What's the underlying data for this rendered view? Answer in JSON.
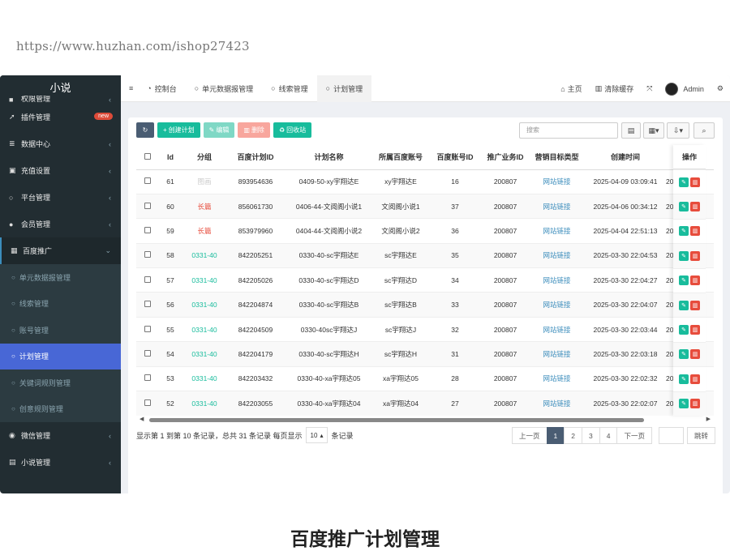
{
  "watermark": "https://www.huzhan.com/ishop27423",
  "sidebar": {
    "brand": "小说",
    "partial_item": "权限管理",
    "items_top": [
      {
        "label": "插件管理",
        "icon": "rocket-icon",
        "badge": "new"
      },
      {
        "label": "数据中心",
        "icon": "database-icon"
      },
      {
        "label": "充值设置",
        "icon": "card-icon"
      },
      {
        "label": "平台管理",
        "icon": "circle-icon"
      },
      {
        "label": "会员管理",
        "icon": "user-icon"
      }
    ],
    "open_group": {
      "label": "百度推广",
      "icon": "grid-icon"
    },
    "sub_items": [
      {
        "label": "单元数据报管理"
      },
      {
        "label": "线索管理"
      },
      {
        "label": "账号管理"
      },
      {
        "label": "计划管理",
        "active": true
      },
      {
        "label": "关键词规则管理"
      },
      {
        "label": "创意规则管理"
      }
    ],
    "items_bottom": [
      {
        "label": "微信管理",
        "icon": "wechat-icon"
      },
      {
        "label": "小说管理",
        "icon": "file-icon"
      }
    ]
  },
  "topbar": {
    "menu_icon": "≡",
    "tabs": [
      {
        "label": "控制台",
        "icon": "dashboard-icon"
      },
      {
        "label": "单元数据报管理",
        "icon": "circle-icon"
      },
      {
        "label": "线索管理",
        "icon": "circle-icon"
      },
      {
        "label": "计划管理",
        "icon": "circle-icon",
        "active": true
      }
    ],
    "home": "主页",
    "clear_cache": "清除缓存",
    "admin": "Admin"
  },
  "toolbar": {
    "refresh": "↻",
    "create": "创建计划",
    "edit": "编辑",
    "delete": "删除",
    "recycle": "回收站",
    "search_placeholder": "搜索"
  },
  "table": {
    "columns": [
      "Id",
      "分组",
      "百度计划ID",
      "计划名称",
      "所属百度账号",
      "百度账号ID",
      "推广业务ID",
      "营销目标类型",
      "创建时间",
      ""
    ],
    "op_header": "操作",
    "rows": [
      {
        "id": "61",
        "group": "图画",
        "group_color": "#cccccc",
        "plan_id": "893954636",
        "name": "0409-50-xy宇翔达E",
        "account": "xy宇翔达E",
        "account_id": "16",
        "biz_id": "200807",
        "target": "网站链接",
        "created": "2025-04-09 03:09:41",
        "extra": "20"
      },
      {
        "id": "60",
        "group": "长篇",
        "group_color": "#e74c3c",
        "plan_id": "856061730",
        "name": "0406-44-文阅阁小说1",
        "account": "文阅阁小说1",
        "account_id": "37",
        "biz_id": "200807",
        "target": "网站链接",
        "created": "2025-04-06 00:34:12",
        "extra": "20"
      },
      {
        "id": "59",
        "group": "长篇",
        "group_color": "#e74c3c",
        "plan_id": "853979960",
        "name": "0404-44-文阅阁小说2",
        "account": "文阅阁小说2",
        "account_id": "36",
        "biz_id": "200807",
        "target": "网站链接",
        "created": "2025-04-04 22:51:13",
        "extra": "20"
      },
      {
        "id": "58",
        "group": "0331-40",
        "group_color": "#18bc9c",
        "plan_id": "842205251",
        "name": "0330-40-sc宇翔达E",
        "account": "sc宇翔达E",
        "account_id": "35",
        "biz_id": "200807",
        "target": "网站链接",
        "created": "2025-03-30 22:04:53",
        "extra": "20"
      },
      {
        "id": "57",
        "group": "0331-40",
        "group_color": "#18bc9c",
        "plan_id": "842205026",
        "name": "0330-40-sc宇翔达D",
        "account": "sc宇翔达D",
        "account_id": "34",
        "biz_id": "200807",
        "target": "网站链接",
        "created": "2025-03-30 22:04:27",
        "extra": "20"
      },
      {
        "id": "56",
        "group": "0331-40",
        "group_color": "#18bc9c",
        "plan_id": "842204874",
        "name": "0330-40-sc宇翔达B",
        "account": "sc宇翔达B",
        "account_id": "33",
        "biz_id": "200807",
        "target": "网站链接",
        "created": "2025-03-30 22:04:07",
        "extra": "20"
      },
      {
        "id": "55",
        "group": "0331-40",
        "group_color": "#18bc9c",
        "plan_id": "842204509",
        "name": "0330-40sc宇翔达J",
        "account": "sc宇翔达J",
        "account_id": "32",
        "biz_id": "200807",
        "target": "网站链接",
        "created": "2025-03-30 22:03:44",
        "extra": "20"
      },
      {
        "id": "54",
        "group": "0331-40",
        "group_color": "#18bc9c",
        "plan_id": "842204179",
        "name": "0330-40-sc宇翔达H",
        "account": "sc宇翔达H",
        "account_id": "31",
        "biz_id": "200807",
        "target": "网站链接",
        "created": "2025-03-30 22:03:18",
        "extra": "20"
      },
      {
        "id": "53",
        "group": "0331-40",
        "group_color": "#18bc9c",
        "plan_id": "842203432",
        "name": "0330-40-xa宇翔达05",
        "account": "xa宇翔达05",
        "account_id": "28",
        "biz_id": "200807",
        "target": "网站链接",
        "created": "2025-03-30 22:02:32",
        "extra": "20"
      },
      {
        "id": "52",
        "group": "0331-40",
        "group_color": "#18bc9c",
        "plan_id": "842203055",
        "name": "0330-40-xa宇翔达04",
        "account": "xa宇翔达04",
        "account_id": "27",
        "biz_id": "200807",
        "target": "网站链接",
        "created": "2025-03-30 22:02:07",
        "extra": "20"
      }
    ]
  },
  "footer": {
    "summary": "显示第 1 到第 10 条记录，总共 31 条记录 每页显示",
    "page_size": "10",
    "suffix": "条记录",
    "prev": "上一页",
    "pages": [
      "1",
      "2",
      "3",
      "4"
    ],
    "current_page": "1",
    "next": "下一页",
    "jump": "跳转"
  },
  "caption": "百度推广计划管理"
}
